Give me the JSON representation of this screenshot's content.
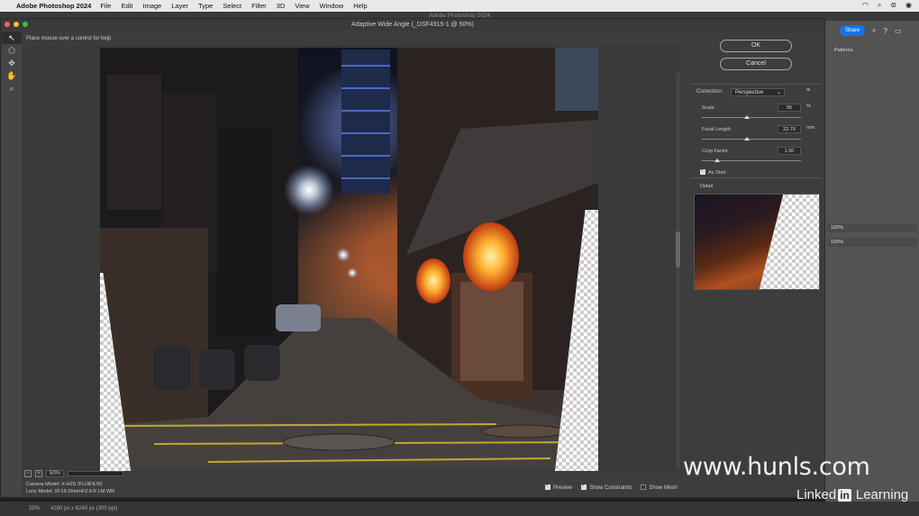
{
  "menubar": {
    "app": "Adobe Photoshop 2024",
    "items": [
      "File",
      "Edit",
      "Image",
      "Layer",
      "Type",
      "Select",
      "Filter",
      "3D",
      "View",
      "Window",
      "Help"
    ]
  },
  "ps_title": "Adobe Photoshop 2024",
  "top_right": {
    "share": "Share"
  },
  "right_panel": {
    "patterns_tab": "Patterns",
    "opacity": "100%",
    "fill": "100%"
  },
  "dialog": {
    "title": "Adaptive Wide Angle (_DSF4915-1 @ 50%)",
    "hint": "Place mouse over a control for help",
    "ok": "OK",
    "cancel": "Cancel",
    "correction_label": "Correction:",
    "correction_value": "Perspective",
    "sliders": [
      {
        "label": "Scale",
        "value": "95",
        "unit": "%",
        "fraction": 0.45
      },
      {
        "label": "Focal Length",
        "value": "22.70",
        "unit": "mm",
        "fraction": 0.45
      },
      {
        "label": "Crop Factor",
        "value": "1.50",
        "unit": "",
        "fraction": 0.15
      }
    ],
    "as_shot": "As Shot",
    "detail": "Detail",
    "zoom": "50%",
    "camera": "Camera Model: X-H2S (FUJIFILM)",
    "lens": "Lens Model: XF16-55mmF2.8 R LM WR",
    "preview": "Preview",
    "show_constraints": "Show Constraints",
    "show_mesh": "Show Mesh"
  },
  "statusbar": {
    "zoom": "25%",
    "dimensions": "4160 px x 6240 px (300 ppi)"
  },
  "watermark": "www.hunls.com",
  "linkedin": {
    "linked": "Linked",
    "in": "in",
    "learning": "Learning"
  }
}
